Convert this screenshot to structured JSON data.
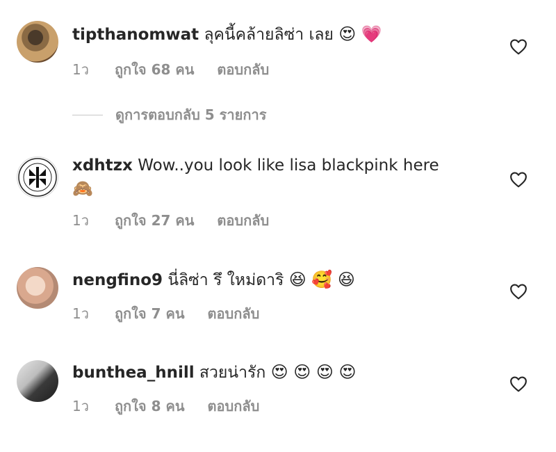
{
  "comments": [
    {
      "username": "tipthanomwat",
      "text": "ลุคนี้คล้ายลิซ่า เลย",
      "emojis": "😍 💗",
      "time": "1ว",
      "likes": "ถูกใจ 68 คน",
      "reply_label": "ตอบกลับ",
      "replies_toggle": "ดูการตอบกลับ 5 รายการ"
    },
    {
      "username": "xdhtzx",
      "text": "Wow..you look like lisa blackpink here",
      "emojis": "🙈",
      "time": "1ว",
      "likes": "ถูกใจ 27 คน",
      "reply_label": "ตอบกลับ"
    },
    {
      "username": "nengfino9",
      "text": "นี่ลิซ่า รึ ใหม่ดาริ",
      "emojis": "😆 🥰 😆",
      "time": "1ว",
      "likes": "ถูกใจ 7 คน",
      "reply_label": "ตอบกลับ"
    },
    {
      "username": "bunthea_hnill",
      "text": "สวยน่ารัก",
      "emojis": "😍 😍 😍 😍",
      "time": "1ว",
      "likes": "ถูกใจ 8 คน",
      "reply_label": "ตอบกลับ"
    }
  ],
  "icons": {
    "like": "heart-outline-icon"
  }
}
